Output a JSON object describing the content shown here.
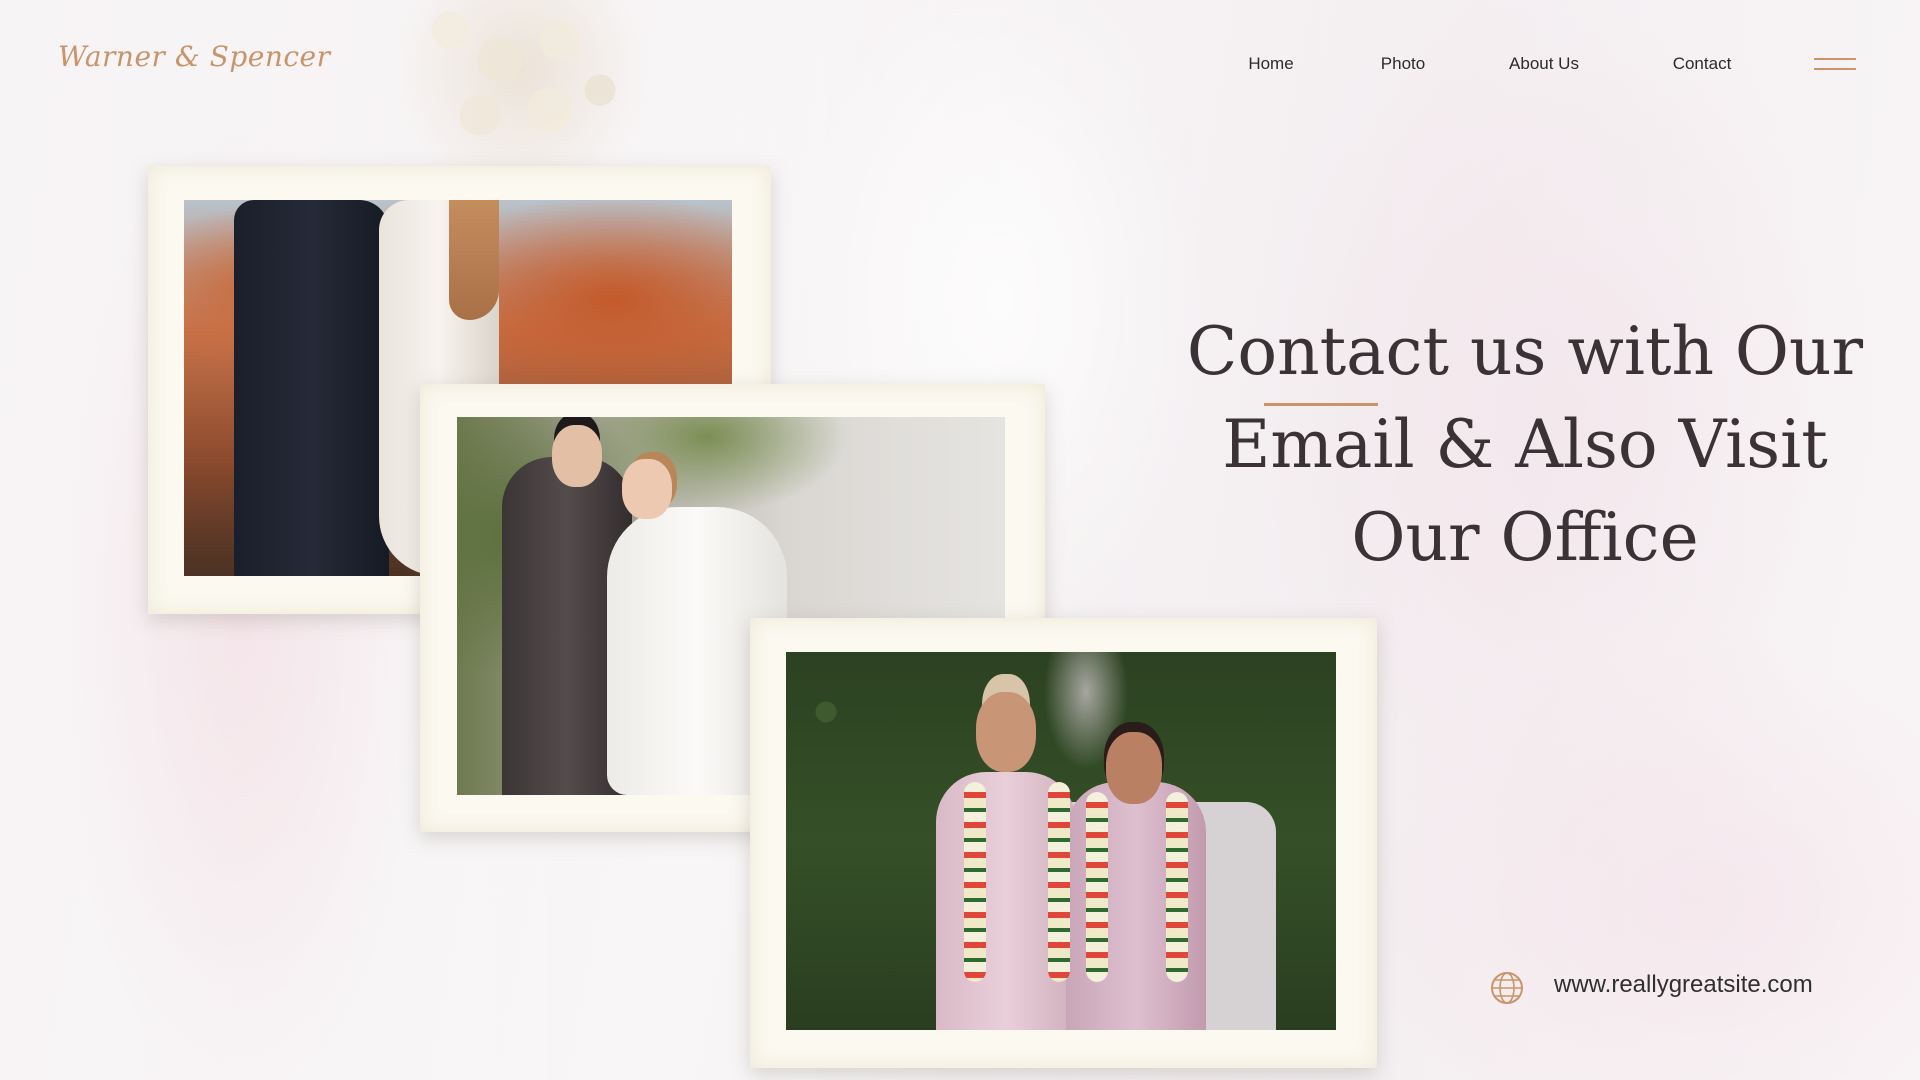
{
  "brand": {
    "logo_text": "Warner & Spencer"
  },
  "nav": {
    "items": [
      {
        "label": "Home"
      },
      {
        "label": "Photo"
      },
      {
        "label": "About Us"
      },
      {
        "label": "Contact"
      }
    ],
    "menu_icon": "hamburger-menu-icon"
  },
  "headline": {
    "lines": [
      "Contact us with Our",
      "Email & Also Visit",
      "Our Office"
    ]
  },
  "contact": {
    "icon": "globe-icon",
    "website": "www.reallygreatsite.com"
  },
  "photos": [
    {
      "name": "couple-autumn-photo"
    },
    {
      "name": "couple-garden-photo"
    },
    {
      "name": "couple-garland-photo"
    }
  ],
  "colors": {
    "accent": "#c9946a",
    "heading": "#3a3234",
    "frame": "#fbf9f0",
    "nav_text": "#2b2b2b"
  }
}
